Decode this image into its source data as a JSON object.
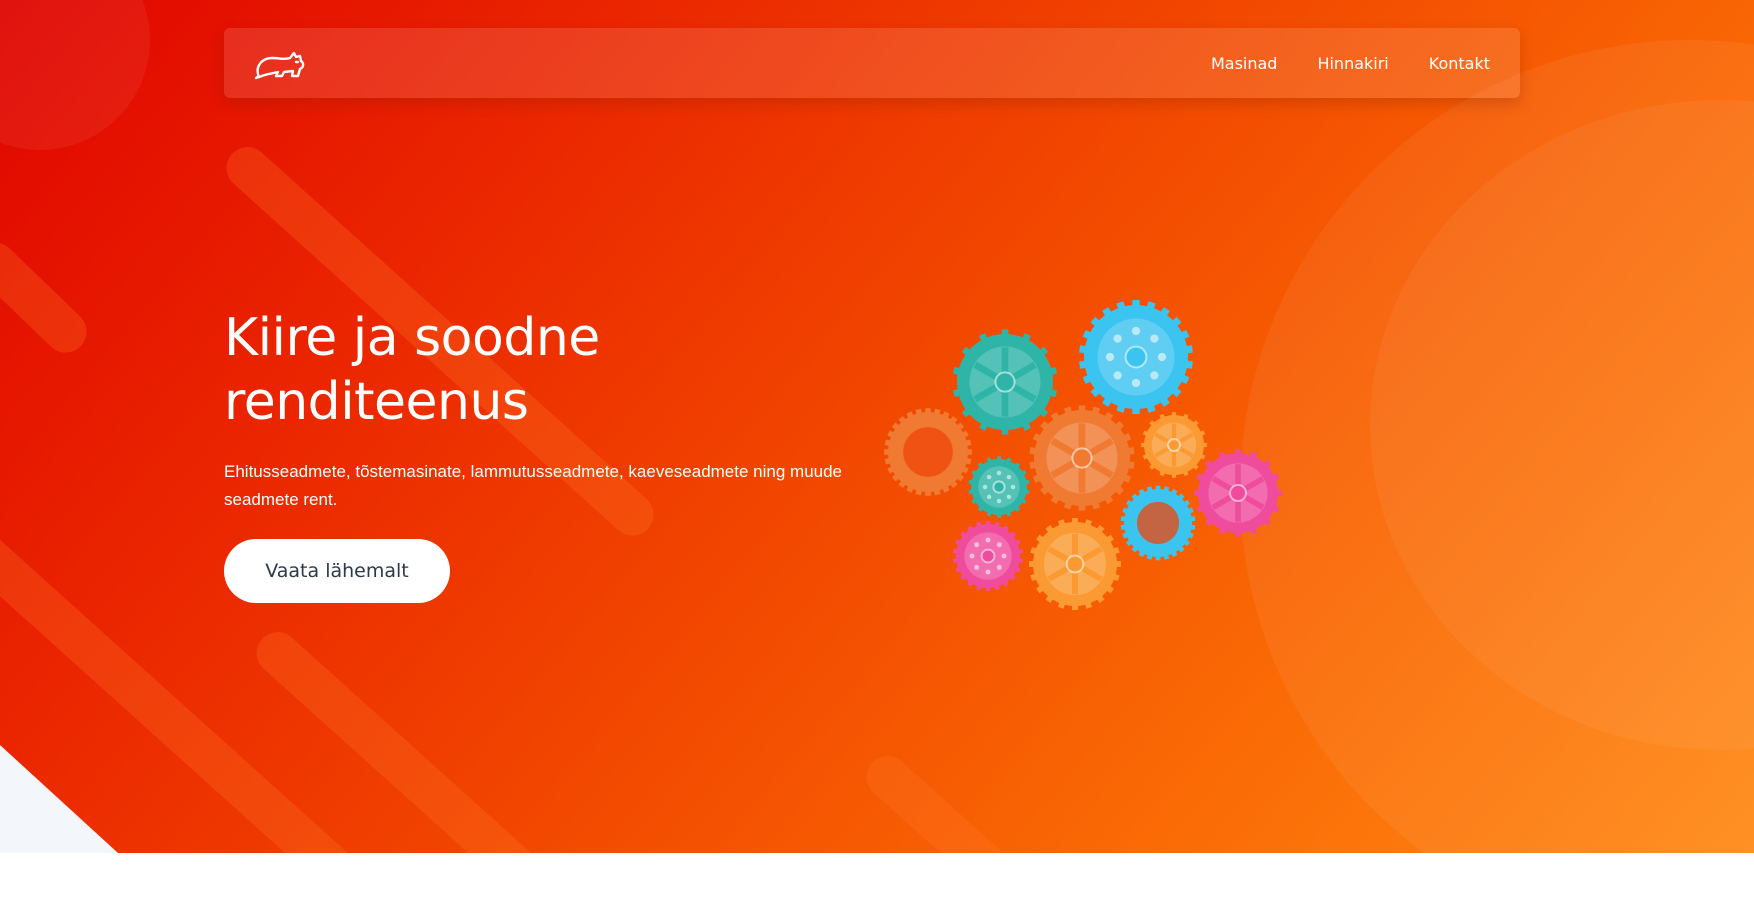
{
  "nav": {
    "logo_icon": "cat-logo-icon",
    "links": [
      {
        "label": "Masinad"
      },
      {
        "label": "Hinnakiri"
      },
      {
        "label": "Kontakt"
      }
    ]
  },
  "hero": {
    "title": "Kiire ja soodne renditeenus",
    "subtitle": "Ehitusseadmete, tõstemasinate, lammutusseadmete, kaeveseadmete ning muude seadmete rent.",
    "cta_label": "Vaata lähemalt",
    "illustration_icon": "gears-illustration"
  },
  "colors": {
    "gradient_start": "#e00400",
    "gradient_end": "#ff8a16",
    "gear_teal": "#2fb5a8",
    "gear_blue": "#3cc4f0",
    "gear_orange": "#fb9a32",
    "gear_pink": "#ef4c9e",
    "gear_dark_orange": "#f07a32"
  }
}
